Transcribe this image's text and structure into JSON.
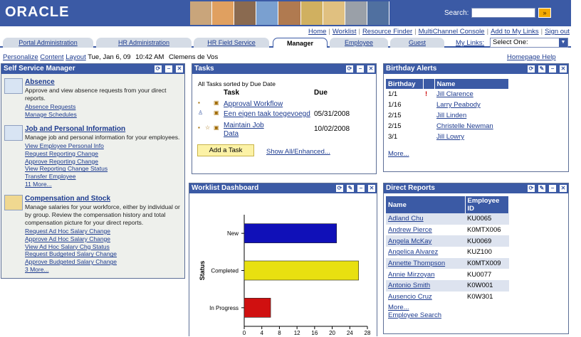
{
  "header": {
    "logo": "ORACLE",
    "search_label": "Search:",
    "search_value": "",
    "search_go": "»",
    "photo_colors": [
      "#c9a57b",
      "#e0a060",
      "#8a6a50",
      "#7aa0d0",
      "#b07a50",
      "#d0b060",
      "#e0c080",
      "#9aa0a8",
      "#5070a0"
    ]
  },
  "top_links": [
    "Home",
    "Worklist",
    "Resource Finder",
    "MultiChannel Console",
    "Add to My Links",
    "Sign out"
  ],
  "tabs": [
    "Portal Administration",
    "HR Administration",
    "HR Field Service",
    "Manager",
    "Employee",
    "Guest"
  ],
  "active_tab": "Manager",
  "my_links": {
    "label": "My Links:",
    "selected": "Select One:"
  },
  "personalize_row": {
    "personalize": "Personalize",
    "content": "Content",
    "layout": "Layout",
    "date": "Tue, Jan 6, 09",
    "time": "10:42 AM",
    "user": "Clemens de Vos",
    "help": "Homepage Help"
  },
  "self_service": {
    "title": "Self Service Manager",
    "sections": [
      {
        "title": "Absence",
        "desc": "Approve and view absence requests from your direct reports.",
        "links": [
          "Absence Requests",
          "Manage Schedules"
        ]
      },
      {
        "title": "Job and Personal Information",
        "desc": "Manage job and personal information for your employees.",
        "links": [
          "View Employee Personal Info",
          "Request Reporting Change",
          "Approve Reporting Change",
          "View Reporting Change Status",
          "Transfer Employee",
          "11 More..."
        ]
      },
      {
        "title": "Compensation and Stock",
        "desc": "Manage salaries for your workforce, either by individual or by group. Review the compensation history and total compensation picture for your direct reports.",
        "links": [
          "Request Ad Hoc Salary Change",
          "Approve Ad Hoc Salary Change",
          "View Ad Hoc Salary Chg Status",
          "Request Budgeted Salary Change",
          "Approve Budgeted Salary Change",
          "3 More..."
        ]
      }
    ]
  },
  "tasks": {
    "title": "Tasks",
    "subtitle": "All Tasks sorted by Due Date",
    "col_task": "Task",
    "col_due": "Due",
    "rows": [
      {
        "task": "Approval Workflow",
        "due": ""
      },
      {
        "task": "Een eigen taak toegevoegd",
        "due": "05/31/2008"
      },
      {
        "task": "Maintain Job Data",
        "due": "10/02/2008"
      }
    ],
    "add_button": "Add a Task",
    "show_all": "Show All/Enhanced..."
  },
  "birthday": {
    "title": "Birthday Alerts",
    "col_birthday": "Birthday",
    "col_name": "Name",
    "rows": [
      {
        "date": "1/1",
        "flag": "!",
        "name": "Jill Clarence"
      },
      {
        "date": "1/16",
        "flag": "",
        "name": "Larry Peabody"
      },
      {
        "date": "2/15",
        "flag": "",
        "name": "Jill Linden"
      },
      {
        "date": "2/15",
        "flag": "",
        "name": "Christelle Newman"
      },
      {
        "date": "3/1",
        "flag": "",
        "name": "Jill Lowry"
      }
    ],
    "more": "More..."
  },
  "worklist": {
    "title": "Worklist Dashboard"
  },
  "chart_data": {
    "type": "bar",
    "orientation": "horizontal",
    "ylabel": "Status",
    "categories": [
      "New",
      "Completed",
      "In Progress"
    ],
    "values": [
      21,
      26,
      6
    ],
    "colors": [
      "#1010b8",
      "#e8e010",
      "#d01010"
    ],
    "xlim": [
      0,
      28
    ],
    "xticks": [
      "0",
      "4",
      "8",
      "12",
      "16",
      "20",
      "24",
      "28"
    ]
  },
  "direct_reports": {
    "title": "Direct Reports",
    "col_name": "Name",
    "col_id": "Employee ID",
    "rows": [
      {
        "name": "Adland Chu",
        "id": "KU0065"
      },
      {
        "name": "Andrew Pierce",
        "id": "K0MTX006"
      },
      {
        "name": "Angela McKay",
        "id": "KU0069"
      },
      {
        "name": "Angelica Alvarez",
        "id": "KUZ100"
      },
      {
        "name": "Annette Thompson",
        "id": "K0MTX009"
      },
      {
        "name": "Annie Mirzoyan",
        "id": "KU0077"
      },
      {
        "name": "Antonio Smith",
        "id": "K0W001"
      },
      {
        "name": "Ausencio Cruz",
        "id": "K0W301"
      }
    ],
    "more": "More...",
    "search": "Employee Search"
  }
}
